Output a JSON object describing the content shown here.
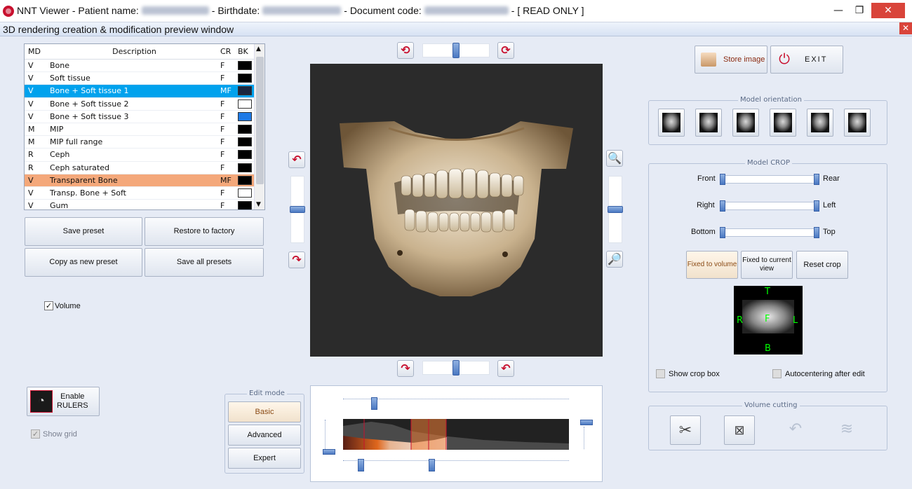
{
  "window": {
    "title_prefix": "NNT Viewer - Patient name:",
    "birthdate_label": "- Birthdate:",
    "doc_label": "- Document code:",
    "read_only": "-   [ READ ONLY ]",
    "minimize": "—",
    "restore": "❐",
    "close": "✕"
  },
  "subwindow": {
    "title": "3D rendering creation & modification preview window",
    "close": "✕"
  },
  "presets": {
    "headers": {
      "md": "MD",
      "desc": "Description",
      "cr": "CR",
      "bk": "BK"
    },
    "rows": [
      {
        "md": "V",
        "desc": "Bone",
        "cr": "F",
        "bk": "#000000"
      },
      {
        "md": "V",
        "desc": "Soft tissue",
        "cr": "F",
        "bk": "#000000"
      },
      {
        "md": "V",
        "desc": "Bone + Soft tissue 1",
        "cr": "MF",
        "bk": "#1a2740"
      },
      {
        "md": "V",
        "desc": "Bone + Soft tissue 2",
        "cr": "F",
        "bk": "#ffffff"
      },
      {
        "md": "V",
        "desc": "Bone + Soft tissue 3",
        "cr": "F",
        "bk": "#1e7ae6"
      },
      {
        "md": "M",
        "desc": "MIP",
        "cr": "F",
        "bk": "#000000"
      },
      {
        "md": "M",
        "desc": "MIP full range",
        "cr": "F",
        "bk": "#000000"
      },
      {
        "md": "R",
        "desc": "Ceph",
        "cr": "F",
        "bk": "#000000"
      },
      {
        "md": "R",
        "desc": "Ceph saturated",
        "cr": "F",
        "bk": "#000000"
      },
      {
        "md": "V",
        "desc": "Transparent Bone",
        "cr": "MF",
        "bk": "#000000"
      },
      {
        "md": "V",
        "desc": "Transp. Bone + Soft",
        "cr": "F",
        "bk": "#ffffff"
      },
      {
        "md": "V",
        "desc": "Gum",
        "cr": "F",
        "bk": "#000000"
      }
    ]
  },
  "buttons": {
    "save_preset": "Save preset",
    "restore_factory": "Restore to factory",
    "copy_preset": "Copy as new preset",
    "save_all": "Save all presets",
    "enable_rulers": "Enable\nRULERS",
    "store_image": "Store image",
    "exit": "EXIT",
    "fixed_volume": "Fixed to volume",
    "fixed_view": "Fixed to current view",
    "reset_crop": "Reset crop"
  },
  "checks": {
    "volume": "Volume",
    "show_grid": "Show grid",
    "show_crop_box": "Show crop box",
    "autocentering": "Autocentering after edit"
  },
  "edit_mode": {
    "label": "Edit mode",
    "basic": "Basic",
    "advanced": "Advanced",
    "expert": "Expert"
  },
  "orientation": {
    "label": "Model orientation"
  },
  "crop": {
    "label": "Model CROP",
    "front": "Front",
    "rear": "Rear",
    "right": "Right",
    "left": "Left",
    "bottom": "Bottom",
    "top": "Top",
    "cube": {
      "t": "T",
      "b": "B",
      "r": "R",
      "l": "L",
      "f": "F"
    }
  },
  "cutting": {
    "label": "Volume cutting"
  },
  "colors": {
    "selected": "#00a2ed",
    "highlight": "#f4a87a",
    "brand": "#c8102e"
  }
}
